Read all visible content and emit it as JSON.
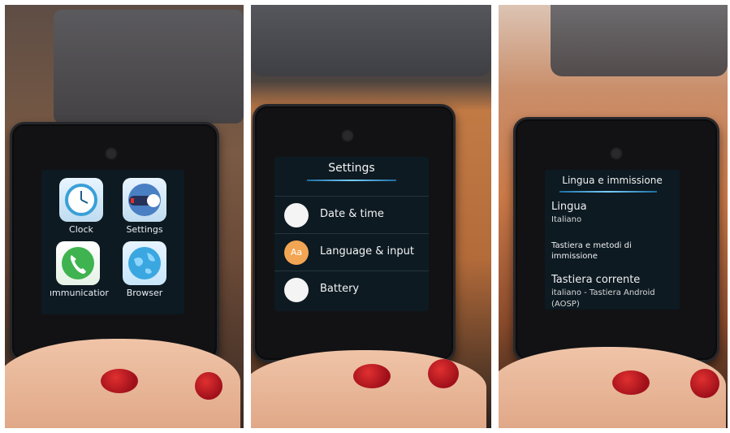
{
  "photo_1": {
    "apps": [
      {
        "label": "Clock",
        "icon": "clock-icon"
      },
      {
        "label": "Settings",
        "icon": "toggle-icon"
      },
      {
        "label": "ımmunicatior",
        "icon": "phone-icon"
      },
      {
        "label": "Browser",
        "icon": "globe-icon"
      }
    ]
  },
  "photo_2": {
    "title": "Settings",
    "items": [
      {
        "label": "Date & time"
      },
      {
        "label": "Language & input",
        "icon_text": "Aa"
      },
      {
        "label": "Battery"
      }
    ]
  },
  "photo_3": {
    "title": "Lingua e immissione",
    "lingua_label": "Lingua",
    "lingua_value": "Italiano",
    "keyboards_label_1": "Tastiera e metodi di",
    "keyboards_label_2": "immissione",
    "current_kb_label": "Tastiera corrente",
    "current_kb_value": "italiano - Tastiera Android",
    "current_kb_value_2": "(AOSP)"
  },
  "colors": {
    "accent": "#7ad0ff",
    "nail": "#c8161e",
    "language_icon": "#f2a553"
  }
}
